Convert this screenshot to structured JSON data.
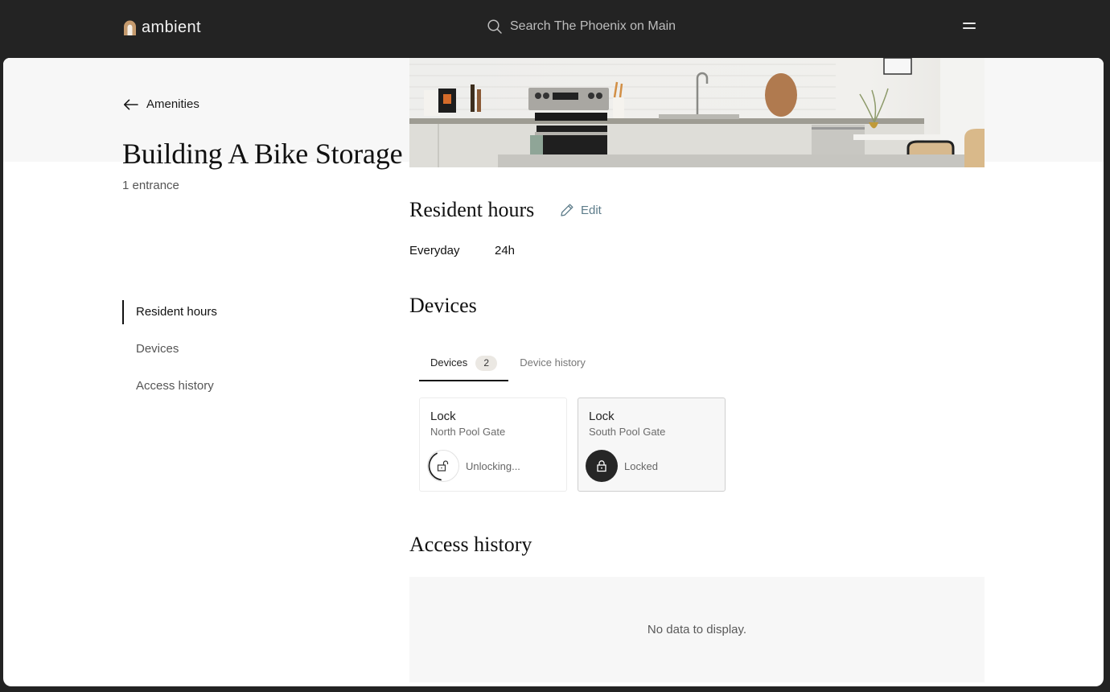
{
  "app": {
    "brand": "ambient",
    "brand_color": "#c59a6d",
    "search_placeholder": "Search The Phoenix on Main",
    "icons": {
      "search": "search-icon",
      "menu": "hamburger-menu-icon",
      "logo": "arch-logo-icon"
    }
  },
  "page": {
    "back_label": "Amenities",
    "title": "Building A Bike Storage",
    "subtitle": "1 entrance",
    "hero_alt": "Kitchen photo"
  },
  "side_nav": {
    "items": [
      {
        "label": "Resident hours",
        "active": true
      },
      {
        "label": "Devices",
        "active": false
      },
      {
        "label": "Access history",
        "active": false
      }
    ]
  },
  "resident_hours": {
    "heading": "Resident hours",
    "edit_label": "Edit",
    "rows": [
      {
        "day": "Everyday",
        "hours": "24h"
      }
    ]
  },
  "devices": {
    "heading": "Devices",
    "tabs": [
      {
        "label": "Devices",
        "count": "2",
        "active": true
      },
      {
        "label": "Device history",
        "active": false
      }
    ],
    "cards": [
      {
        "type": "Lock",
        "name": "North Pool Gate",
        "status": "Unlocking...",
        "state": "unlocking"
      },
      {
        "type": "Lock",
        "name": "South Pool Gate",
        "status": "Locked",
        "state": "locked"
      }
    ]
  },
  "access_history": {
    "heading": "Access history",
    "empty_text": "No data to display."
  }
}
